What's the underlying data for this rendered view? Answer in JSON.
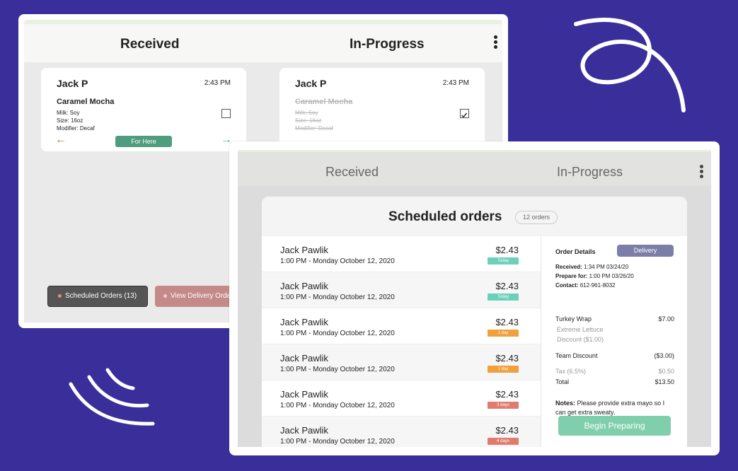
{
  "colors": {
    "background": "#3a2f9a",
    "accent_green": "#4f9d7f",
    "today": "#6bd1b8",
    "day": "#f0a03c",
    "days": "#e07b6e"
  },
  "back": {
    "tabs": {
      "received": "Received",
      "in_progress": "In-Progress"
    },
    "card_received": {
      "name": "Jack P",
      "time": "2:43 PM",
      "item": "Caramel Mocha",
      "milk": "Milk: Soy",
      "size": "Size: 16oz",
      "modifier": "Modifier: Decaf",
      "pill": "For Here",
      "checked": false
    },
    "card_progress": {
      "name": "Jack P",
      "time": "2:43 PM",
      "item": "Caramel Mocha",
      "milk": "Milk: Soy",
      "size": "Size: 16oz",
      "modifier": "Modifier: Decaf",
      "checked": true
    },
    "scheduled_button": "Scheduled Orders (13)",
    "delivery_button": "View Delivery Orders"
  },
  "front": {
    "tabs": {
      "received": "Received",
      "in_progress": "In-Progress"
    },
    "title": "Scheduled orders",
    "count": "12 orders",
    "orders": [
      {
        "name": "Jack Pawlik",
        "datetime": "1:00 PM - Monday October 12, 2020",
        "price": "$2.43",
        "badge": "Today",
        "badge_color": "#6bd1b8"
      },
      {
        "name": "Jack Pawlik",
        "datetime": "1:00 PM - Monday October 12, 2020",
        "price": "$2.43",
        "badge": "Today",
        "badge_color": "#6bd1b8"
      },
      {
        "name": "Jack Pawlik",
        "datetime": "1:00 PM - Monday October 12, 2020",
        "price": "$2.43",
        "badge": "1 day",
        "badge_color": "#f0a03c"
      },
      {
        "name": "Jack Pawlik",
        "datetime": "1:00 PM - Monday October 12, 2020",
        "price": "$2.43",
        "badge": "1 day",
        "badge_color": "#f0a03c"
      },
      {
        "name": "Jack Pawlik",
        "datetime": "1:00 PM - Monday October 12, 2020",
        "price": "$2.43",
        "badge": "3 days",
        "badge_color": "#e07b6e"
      },
      {
        "name": "Jack Pawlik",
        "datetime": "1:00 PM - Monday October 12, 2020",
        "price": "$2.43",
        "badge": "4 days",
        "badge_color": "#e07b6e"
      }
    ],
    "details": {
      "heading": "Order Details",
      "type": "Delivery",
      "received_label": "Received:",
      "received": "1:34 PM 03/24/20",
      "prepare_label": "Prepare for:",
      "prepare": "1:00 PM 03/26/20",
      "contact_label": "Contact:",
      "contact": "612-961-8032",
      "item": "Turkey Wrap",
      "item_price": "$7.00",
      "item_mod1": "Extreme Lettuce",
      "item_mod2": "Discount ($1.00)",
      "team_discount": "Team Discount",
      "team_discount_value": "($3.00)",
      "tax": "Tax (6.5%)",
      "tax_value": "$0.50",
      "total": "Total",
      "total_value": "$13.50",
      "notes_label": "Notes:",
      "notes": "Please provide extra mayo so I can get extra sweaty.",
      "button": "Begin Preparing"
    }
  }
}
